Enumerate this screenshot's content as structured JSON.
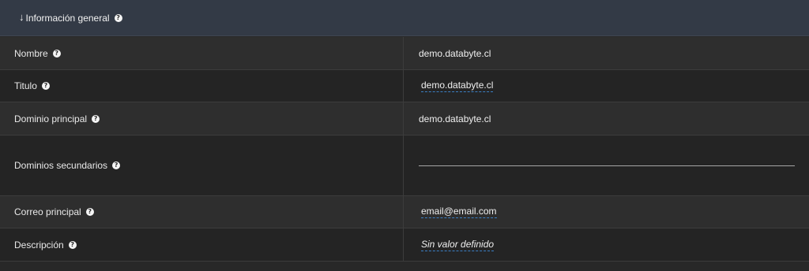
{
  "section": {
    "arrow": "↓",
    "title": "Información general",
    "help": "?"
  },
  "rows": [
    {
      "label": "Nombre",
      "value": "demo.databyte.cl",
      "editable": false
    },
    {
      "label": "Titulo",
      "value": "demo.databyte.cl",
      "editable": true
    },
    {
      "label": "Dominio principal",
      "value": "demo.databyte.cl",
      "editable": false
    },
    {
      "label": "Dominios secundarios",
      "value": "",
      "editable": true
    },
    {
      "label": "Correo principal",
      "value": "email@email.com",
      "editable": true
    },
    {
      "label": "Descripción",
      "value": "Sin valor definido",
      "editable": true
    }
  ],
  "colors": {
    "header_bg": "#333a46",
    "row_odd": "#2e2e2e",
    "row_even": "#242424",
    "editable_underline": "#3b7fc4"
  }
}
